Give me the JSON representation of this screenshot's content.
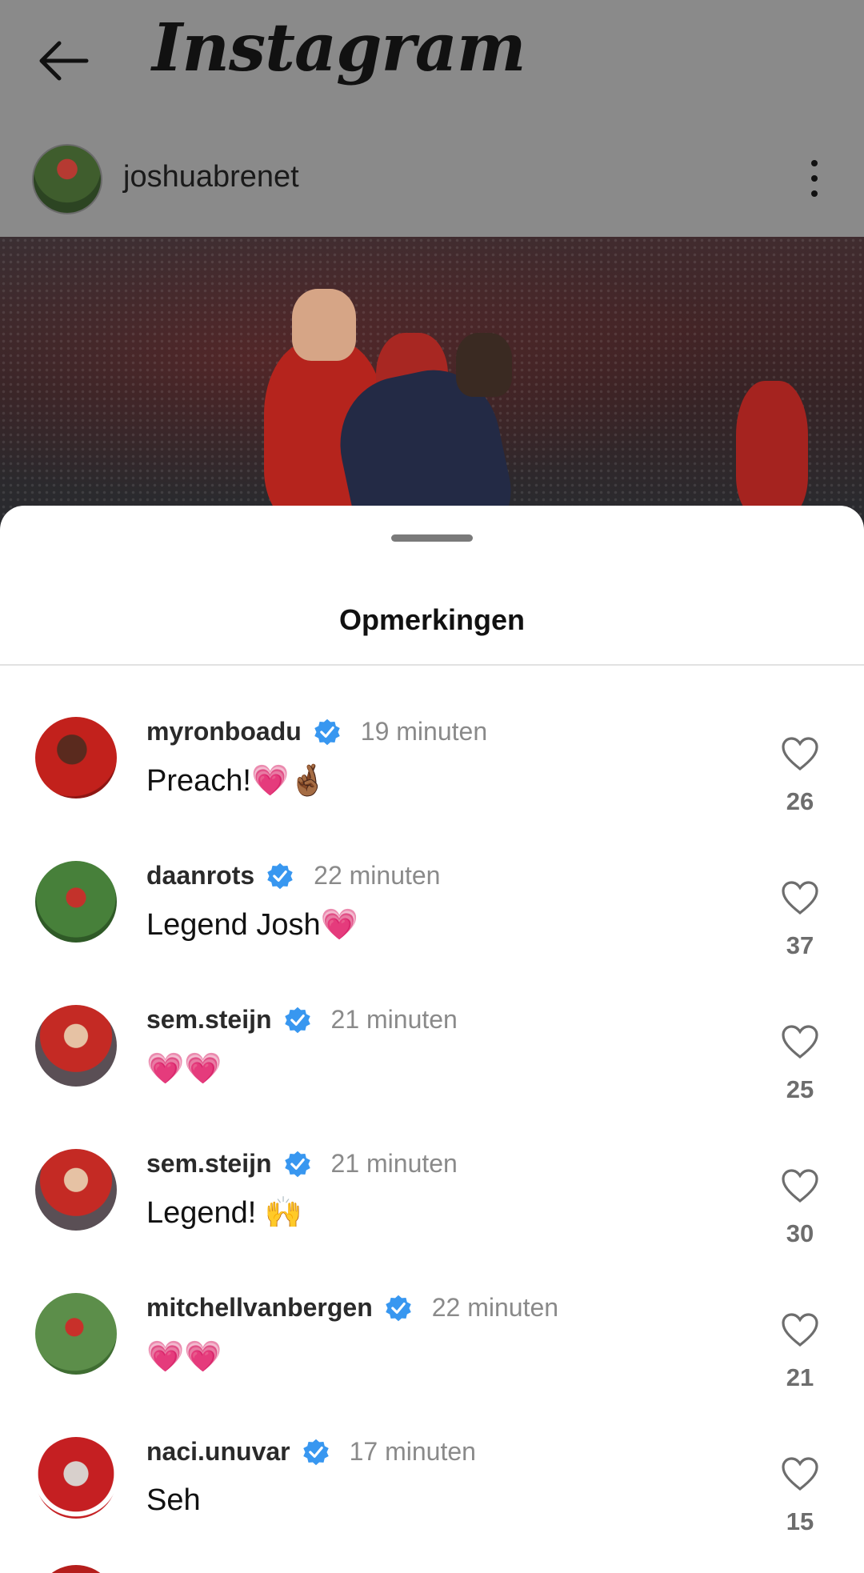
{
  "header": {
    "back_icon": "arrow-left-icon",
    "app_title": "Instagram",
    "post_username": "joshuabrenet",
    "more_icon": "more-vertical-icon"
  },
  "sheet": {
    "title": "Opmerkingen"
  },
  "comments": [
    {
      "username": "myronboadu",
      "verified": true,
      "time": "19 minuten",
      "text": "Preach!💗🤞🏾",
      "likes": "26"
    },
    {
      "username": "daanrots",
      "verified": true,
      "time": "22 minuten",
      "text": "Legend Josh💗",
      "likes": "37"
    },
    {
      "username": "sem.steijn",
      "verified": true,
      "time": "21 minuten",
      "text": "💗💗",
      "likes": "25"
    },
    {
      "username": "sem.steijn",
      "verified": true,
      "time": "21 minuten",
      "text": "Legend! 🙌",
      "likes": "30"
    },
    {
      "username": "mitchellvanbergen",
      "verified": true,
      "time": "22 minuten",
      "text": "💗💗",
      "likes": "21"
    },
    {
      "username": "naci.unuvar",
      "verified": true,
      "time": "17 minuten",
      "text": "Seh",
      "likes": "15"
    }
  ],
  "colors": {
    "verified_badge": "#3897f0",
    "like_count": "#6d6d6d",
    "time": "#8a8a8a"
  }
}
